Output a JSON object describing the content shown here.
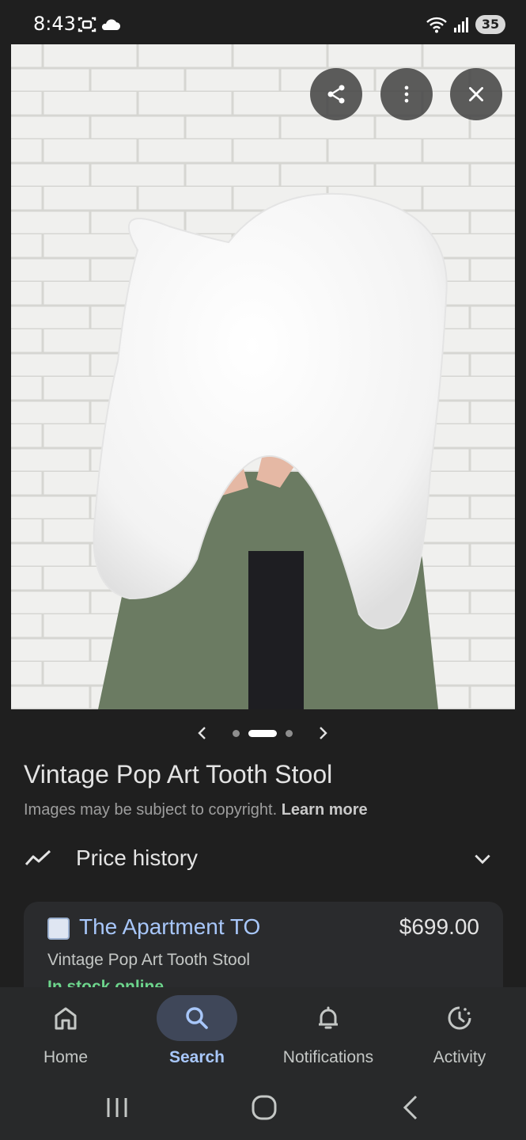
{
  "status_bar": {
    "time": "8:43",
    "battery": "35"
  },
  "viewer": {
    "share_label": "share",
    "more_label": "more",
    "close_label": "close",
    "pager": {
      "total": 3,
      "current": 2
    }
  },
  "product": {
    "title": "Vintage Pop Art Tooth Stool",
    "copyright_text": "Images may be subject to copyright.",
    "learn_more": "Learn more",
    "price_history_label": "Price history"
  },
  "listing": {
    "store_name": "The Apartment TO",
    "price": "$699.00",
    "product_name": "Vintage Pop Art Tooth Stool",
    "availability": "In stock online"
  },
  "bottom_nav": {
    "items": [
      {
        "label": "Home",
        "icon": "home-icon",
        "active": false
      },
      {
        "label": "Search",
        "icon": "search-icon",
        "active": true
      },
      {
        "label": "Notifications",
        "icon": "bell-icon",
        "active": false
      },
      {
        "label": "Activity",
        "icon": "activity-icon",
        "active": false
      }
    ]
  },
  "colors": {
    "accent": "#a8c7fa",
    "background": "#1f1f1f",
    "in_stock": "#6dd58c"
  }
}
